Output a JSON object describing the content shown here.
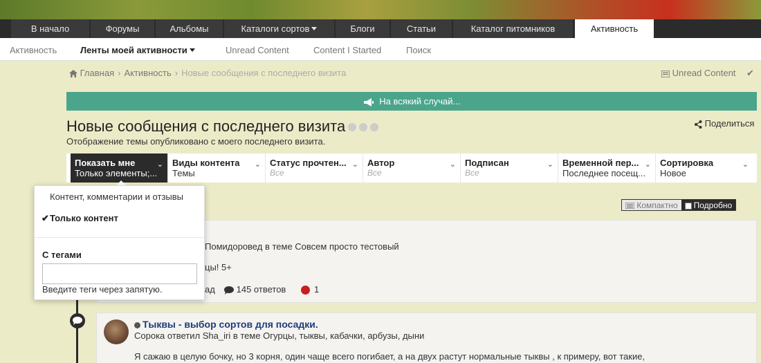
{
  "main_nav": {
    "items": [
      {
        "label": "В начало"
      },
      {
        "label": "Форумы"
      },
      {
        "label": "Альбомы"
      },
      {
        "label": "Каталоги сортов"
      },
      {
        "label": "Блоги"
      },
      {
        "label": "Статьи"
      },
      {
        "label": "Каталог питомников"
      },
      {
        "label": "Активность"
      }
    ]
  },
  "sub_nav": {
    "items": [
      {
        "label": "Активность"
      },
      {
        "label": "Ленты моей активности"
      },
      {
        "label": "Unread Content"
      },
      {
        "label": "Content I Started"
      },
      {
        "label": "Поиск"
      }
    ]
  },
  "breadcrumb": {
    "home": "Главная",
    "section": "Активность",
    "current": "Новые сообщения с последнего визита"
  },
  "top_right": {
    "unread": "Unread Content"
  },
  "announcement": "На всякий случай...",
  "page": {
    "title": "Новые сообщения с последнего визита",
    "subtitle": "Отображение темы опубликовано с моего последнего визита.",
    "share": "Поделиться"
  },
  "filters": [
    {
      "label": "Показать мне",
      "value": "Только элементы;..."
    },
    {
      "label": "Виды контента",
      "value": "Темы"
    },
    {
      "label": "Статус прочтен...",
      "value": "Все"
    },
    {
      "label": "Автор",
      "value": "Все"
    },
    {
      "label": "Подписан",
      "value": "Все"
    },
    {
      "label": "Временной пер...",
      "value": "Последнее посещ..."
    },
    {
      "label": "Сортировка",
      "value": "Новое"
    }
  ],
  "dropdown": {
    "option1": "Контент, комментарии и отзывы",
    "option2": "Только контент",
    "tags_label": "С тегами",
    "tags_input_value": "",
    "tags_hint": "Введите теги через запятую."
  },
  "view_toggle": {
    "compact": "Компактно",
    "full": "Подробно"
  },
  "card1": {
    "meta": "Помидоровед в теме Совсем просто тестовый",
    "snippet": "цы! 5+",
    "ago": "ад",
    "replies": "145 ответов",
    "reactions": "1"
  },
  "card2": {
    "title": "Тыквы - выбор сортов для посадки.",
    "meta": "Сорока ответил Sha_iri в теме Огурцы, тыквы, кабачки, арбузы, дыни",
    "snippet": "Я сажаю в целую бочку, но 3 корня, один чаще всего погибает, а на двух растут нормальные тыквы , к примеру, вот такие,"
  },
  "colors": {
    "nav_dark": "#2b2b2b",
    "announce_green": "#4aa58a",
    "page_bg": "#ecebc7",
    "link_blue": "#1f3b7a"
  }
}
